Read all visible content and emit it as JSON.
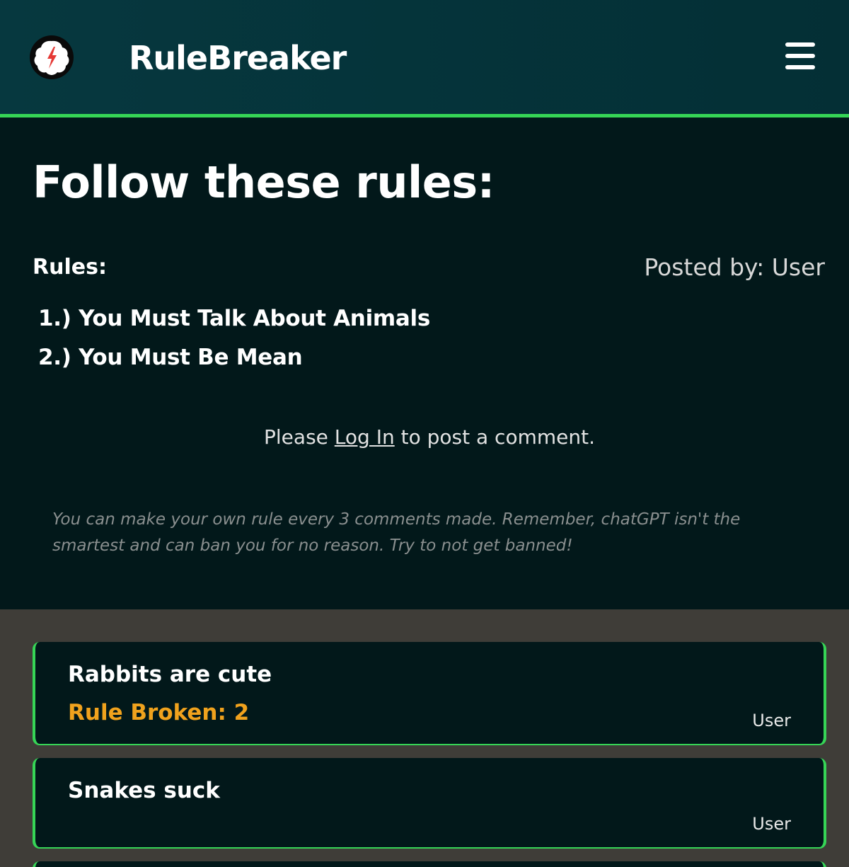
{
  "header": {
    "brand": "RuleBreaker",
    "logo_icon": "brain-lightning-icon",
    "menu_icon": "hamburger-menu-icon",
    "accent_color": "#36d556"
  },
  "main": {
    "title": "Follow these rules:",
    "rules_label": "Rules:",
    "posted_by": "Posted by: User",
    "rules": [
      "1.) You Must Talk About Animals",
      "2.) You Must Be Mean"
    ],
    "login_prompt": {
      "before": "Please ",
      "link": "Log In",
      "after": " to post a comment."
    },
    "note": "You can make your own rule every 3 comments made. Remember, chatGPT isn't the smartest and can ban you for no reason. Try to not get banned!"
  },
  "comments": [
    {
      "text": "Rabbits are cute",
      "rule_broken": "Rule Broken: 2",
      "user": "User"
    },
    {
      "text": "Snakes suck",
      "user": "User"
    }
  ],
  "colors": {
    "rule_broken": "#f0a21d",
    "background": "#02181a",
    "comments_background": "#3f3d38"
  }
}
